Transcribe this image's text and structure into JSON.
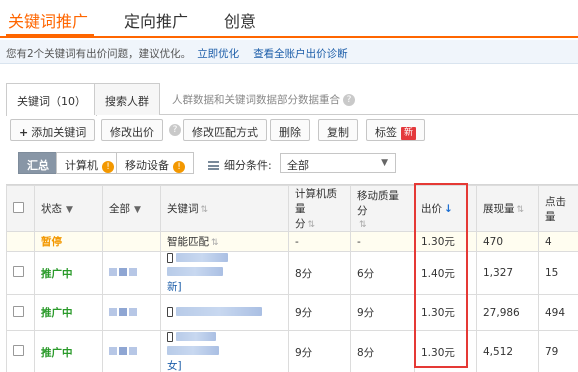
{
  "top_tabs": [
    {
      "label": "关键词推广",
      "active": true
    },
    {
      "label": "定向推广",
      "active": false
    },
    {
      "label": "创意",
      "active": false
    }
  ],
  "notice": {
    "text": "您有2个关键词有出价问题，建议优化。",
    "link_optimize": "立即优化",
    "link_diagnose": "查看全账户出价诊断"
  },
  "sub_tabs": {
    "keywords": "关键词（10）",
    "audience": "搜索人群",
    "note": "人群数据和关键词数据部分数据重合"
  },
  "toolbar": {
    "add_keyword": "添加关键词",
    "modify_bid": "修改出价",
    "modify_match": "修改匹配方式",
    "delete": "删除",
    "copy": "复制",
    "tag": "标签",
    "new_badge": "新"
  },
  "filter": {
    "summary": "汇总",
    "computer": "计算机",
    "mobile": "移动设备",
    "condition_label": "细分条件:",
    "condition_value": "全部"
  },
  "table": {
    "headers": {
      "status": "状态",
      "all": "全部",
      "keyword": "关键词",
      "pc_quality_1": "计算机质量",
      "pc_quality_2": "分",
      "mobile_quality_1": "移动质量分",
      "bid": "出价",
      "impressions": "展现量",
      "clicks": "点击量"
    },
    "rows": [
      {
        "status": "暂停",
        "keyword_line1": "智能匹配",
        "keyword_line2": "",
        "pc_quality": "-",
        "mobile_quality": "-",
        "bid": "1.30元",
        "impressions": "470",
        "clicks": "4"
      },
      {
        "status": "推广中",
        "keyword_line1": "",
        "keyword_line2": "新]",
        "pc_quality": "8分",
        "mobile_quality": "6分",
        "bid": "1.40元",
        "impressions": "1,327",
        "clicks": "15"
      },
      {
        "status": "推广中",
        "keyword_line1": "",
        "keyword_line2": "",
        "pc_quality": "9分",
        "mobile_quality": "9分",
        "bid": "1.30元",
        "impressions": "27,986",
        "clicks": "494"
      },
      {
        "status": "推广中",
        "keyword_line1": "",
        "keyword_line2": "女]",
        "pc_quality": "9分",
        "mobile_quality": "8分",
        "bid": "1.30元",
        "impressions": "4,512",
        "clicks": "79"
      }
    ]
  },
  "colors": {
    "accent": "#ff6600",
    "paused": "#f39800",
    "active": "#2a9a2a",
    "highlight_box": "#e53935",
    "link": "#1d5ea9"
  }
}
